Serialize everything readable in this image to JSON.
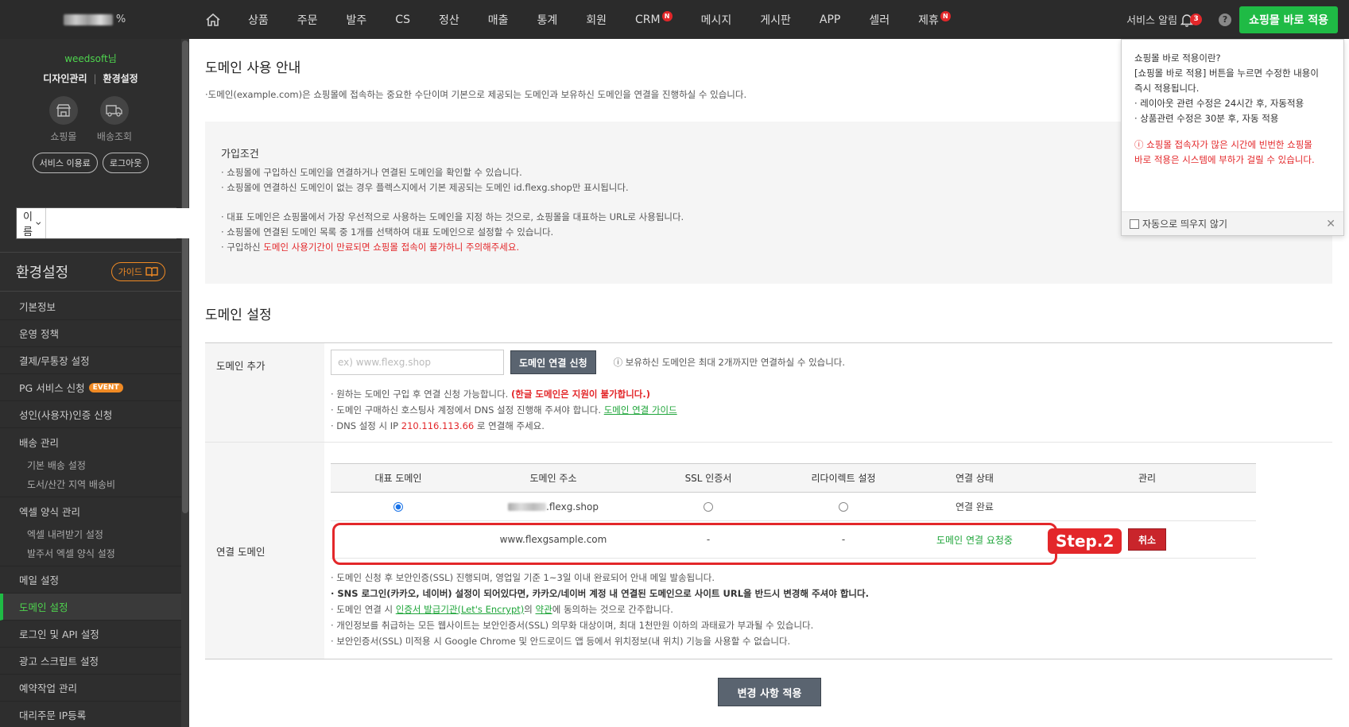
{
  "topbar": {
    "logo_mark": "%",
    "nav": [
      {
        "label": "상품"
      },
      {
        "label": "주문"
      },
      {
        "label": "발주"
      },
      {
        "label": "CS"
      },
      {
        "label": "정산"
      },
      {
        "label": "매출"
      },
      {
        "label": "통계"
      },
      {
        "label": "회원"
      },
      {
        "label": "CRM",
        "badge": "N"
      },
      {
        "label": "메시지"
      },
      {
        "label": "게시판"
      },
      {
        "label": "APP"
      },
      {
        "label": "셀러"
      },
      {
        "label": "제휴",
        "badge": "N"
      }
    ],
    "service_alarm": "서비스 알림",
    "alarm_count": "3",
    "help": "?",
    "apply_now": "쇼핑몰 바로 적용"
  },
  "sidebar": {
    "user_name": "weedsoft님",
    "link_design": "디자인관리",
    "link_settings": "환경설정",
    "icon_shop": "쇼핑몰",
    "icon_delivery": "배송조회",
    "btn_service_fee": "서비스 이용료",
    "btn_logout": "로그아웃",
    "search_select": "이름",
    "section_title": "환경설정",
    "guide_btn": "가이드",
    "menu": [
      {
        "label": "기본정보"
      },
      {
        "label": "운영 정책"
      },
      {
        "label": "결제/무통장 설정"
      },
      {
        "label": "PG 서비스 신청",
        "badge": "EVENT"
      },
      {
        "label": "성인(사용자)인증 신청"
      },
      {
        "label": "배송 관리",
        "subs": [
          "기본 배송 설정",
          "도서/산간 지역 배송비"
        ]
      },
      {
        "label": "엑셀 양식 관리",
        "subs": [
          "엑셀 내려받기 설정",
          "발주서 엑셀 양식 설정"
        ]
      },
      {
        "label": "메일 설정"
      },
      {
        "label": "도메인 설정",
        "active": true
      },
      {
        "label": "로그인 및 API 설정"
      },
      {
        "label": "광고 스크립트 설정"
      },
      {
        "label": "예약작업 관리"
      },
      {
        "label": "대리주문 IP등록"
      }
    ]
  },
  "main": {
    "title1": "도메인 사용 안내",
    "desc1": "·도메인(example.com)은 쇼핑몰에 접속하는 중요한 수단이며 기본으로 제공되는 도메인과 보유하신 도메인을 연결을 진행하실 수 있습니다.",
    "info": {
      "title": "가입조건",
      "line1": "· 쇼핑몰에 구입하신 도메인을 연결하거나 연결된 도메인을 확인할 수 있습니다.",
      "line2": "· 쇼핑몰에 연결하신 도메인이 없는 경우 플렉스지에서 기본 제공되는 도메인 id.flexg.shop만 표시됩니다.",
      "line3": "· 대표 도메인은 쇼핑몰에서 가장 우선적으로 사용하는 도메인을 지정 하는 것으로, 쇼핑몰을 대표하는 URL로 사용됩니다.",
      "line4": "· 쇼핑몰에 연결된 도메인 목록 중 1개를 선택하여 대표 도메인으로 설정할 수 있습니다.",
      "line5_prefix": "· 구입하신 ",
      "line5_red": "도메인 사용기간이 만료되면 쇼핑몰 접속이 불가하니 주의해주세요."
    },
    "title2": "도메인 설정",
    "add": {
      "label": "도메인 추가",
      "placeholder": "ex) www.flexg.shop",
      "button": "도메인 연결 신청",
      "note": "ⓘ 보유하신 도메인은 최대 2개까지만 연결하실 수 있습니다.",
      "b1_prefix": "· 원하는 도메인 구입 후 연결 신청 가능합니다. ",
      "b1_red": "(한글 도메인은 지원이 불가합니다.)",
      "b2_prefix": "· 도메인 구매하신 호스팅사 계정에서 DNS 설정 진행해 주셔야 합니다. ",
      "b2_link": "도메인 연결 가이드",
      "b3_prefix": "· DNS 설정 시 IP ",
      "b3_ip": "210.116.113.66",
      "b3_suffix": " 로 연결해 주세요."
    },
    "linked": {
      "label": "연결 도메인",
      "headers": [
        "대표 도메인",
        "도메인 주소",
        "SSL 인증서",
        "리다이렉트 설정",
        "연결 상태",
        "관리"
      ],
      "row1": {
        "domain_suffix": ".flexg.shop",
        "status": "연결 완료"
      },
      "row2": {
        "domain": "www.flexgsample.com",
        "ssl": "-",
        "redirect": "-",
        "status": "도메인 연결 요청중",
        "action": "취소"
      },
      "step": "Step.2",
      "n1": "· 도메인 신청 후 보안인증(SSL) 진행되며, 영업일 기준 1~3일 이내 완료되어 안내 메일 발송됩니다.",
      "n2": "· SNS 로그인(카카오, 네이버) 설정이 되어있다면, 카카오/네이버 계정 내 연결된 도메인으로 사이트 URL을 반드시 변경해 주셔야 합니다.",
      "n3_prefix": "· 도메인 연결 시 ",
      "n3_link1": "인증서 발급기관(Let's Encrypt)",
      "n3_mid": "의 ",
      "n3_link2": "약관",
      "n3_suffix": "에 동의하는 것으로 간주합니다.",
      "n4": "· 개인정보를 취급하는 모든 웹사이트는 보안인증서(SSL) 의무화 대상이며, 최대 1천만원 이하의 과태료가 부과될 수 있습니다.",
      "n5": "· 보안인증서(SSL) 미적용 시 Google Chrome 및 안드로이드 앱 등에서 위치정보(내 위치) 기능을 사용할 수 없습니다."
    },
    "apply_changes": "변경 사항 적용"
  },
  "popup": {
    "l1": "쇼핑몰 바로 적용이란?",
    "l2": "[쇼핑몰 바로 적용] 버튼을 누르면 수정한 내용이",
    "l3": "즉시 적용됩니다.",
    "l4": "· 레이아웃 관련 수정은 24시간 후, 자동적용",
    "l5": "· 상품관련 수정은 30분 후, 자동 적용",
    "w1": "ⓘ 쇼핑몰 접속자가 많은 시간에 빈번한 쇼핑몰",
    "w2": "바로 적용은 시스템에 부하가 걸릴 수 있습니다.",
    "checkbox": "자동으로 띄우지 않기",
    "close": "✕"
  }
}
